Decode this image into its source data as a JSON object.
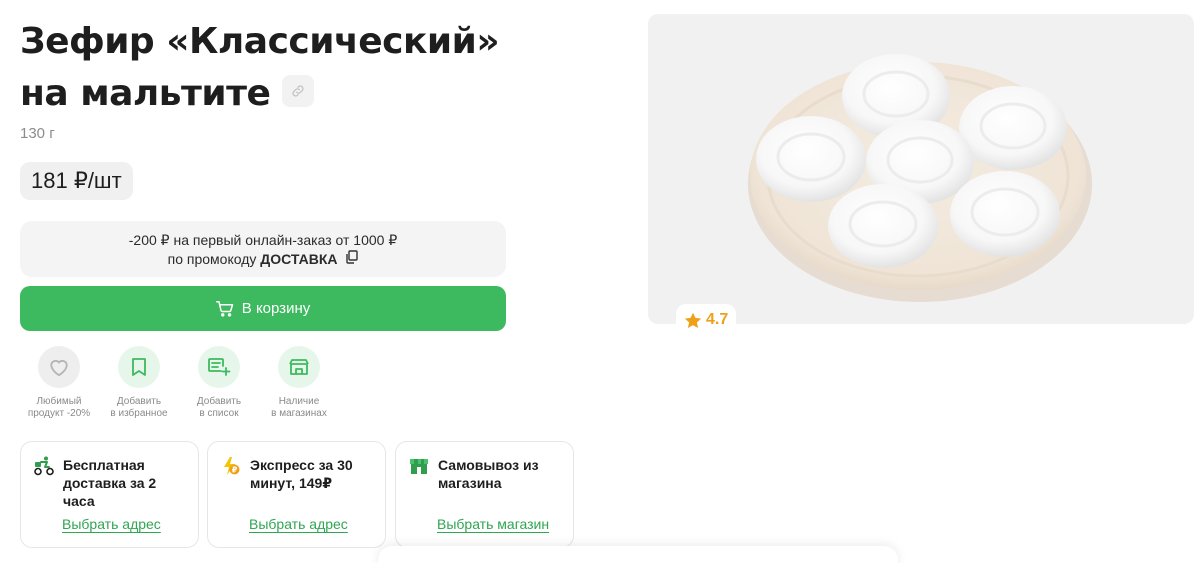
{
  "product": {
    "title_line1": "Зефир «Классический»",
    "title_line2": "на мальтите",
    "weight": "130 г",
    "price": "181 ₽/шт",
    "rating": "4.7"
  },
  "promo": {
    "line1": "-200 ₽ на первый онлайн-заказ от 1000 ₽",
    "line2_prefix": "по промокоду",
    "code": "ДОСТАВКА"
  },
  "cart": {
    "label": "В корзину"
  },
  "actions": [
    {
      "label": "Любимый\nпродукт -20%",
      "icon": "heart-icon"
    },
    {
      "label": "Добавить\nв избранное",
      "icon": "bookmark-icon"
    },
    {
      "label": "Добавить\nв список",
      "icon": "add-to-list-icon"
    },
    {
      "label": "Наличие\nв магазинах",
      "icon": "store-icon"
    }
  ],
  "delivery": [
    {
      "title": "Бесплатная доставка за 2 часа",
      "link": "Выбрать адрес",
      "icon": "courier-bike-icon"
    },
    {
      "title": "Экспресс за 30 минут, 149₽",
      "link": "Выбрать адрес",
      "icon": "express-lightning-icon"
    },
    {
      "title": "Самовывоз из магазина",
      "link": "Выбрать магазин",
      "icon": "pickup-store-icon"
    }
  ],
  "colors": {
    "brand_green": "#3dba5f",
    "link_green": "#2fa652",
    "rating_orange": "#f0a018"
  }
}
